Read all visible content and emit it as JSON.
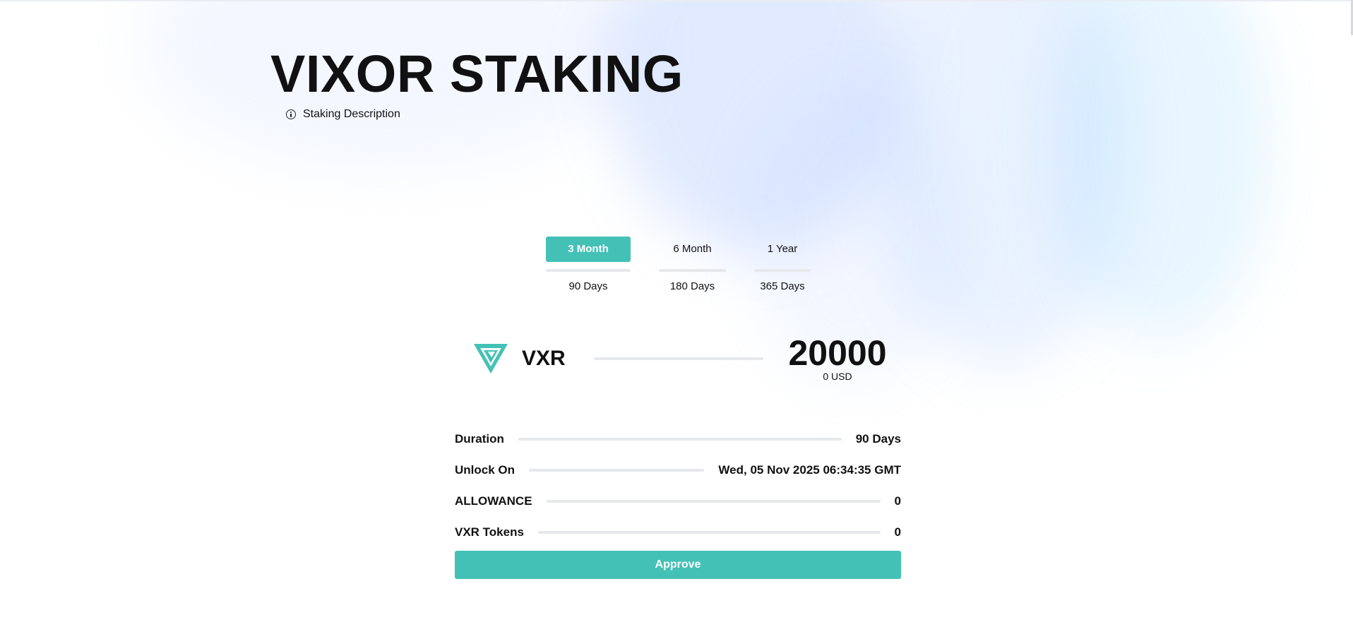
{
  "page": {
    "title": "VIXOR STAKING",
    "description_link": "Staking Description",
    "description_icon": "info-icon"
  },
  "durations": [
    {
      "label": "3 Month",
      "days": "90 Days",
      "selected": true
    },
    {
      "label": "6 Month",
      "days": "180 Days",
      "selected": false
    },
    {
      "label": "1 Year",
      "days": "365 Days",
      "selected": false
    }
  ],
  "token": {
    "symbol": "VXR",
    "logo_icon": "vxr-logo-icon",
    "amount": "20000",
    "usd_value": "0 USD"
  },
  "details": {
    "duration": {
      "label": "Duration",
      "value": "90 Days"
    },
    "unlock_on": {
      "label": "Unlock On",
      "value": "Wed, 05 Nov 2025 06:34:35 GMT"
    },
    "allowance": {
      "label": "ALLOWANCE",
      "value": "0"
    },
    "vxr_tokens": {
      "label": "VXR Tokens",
      "value": "0"
    }
  },
  "actions": {
    "approve_label": "Approve"
  },
  "colors": {
    "accent": "#44c1b6",
    "text": "#111111",
    "divider": "#e6e8ec"
  }
}
